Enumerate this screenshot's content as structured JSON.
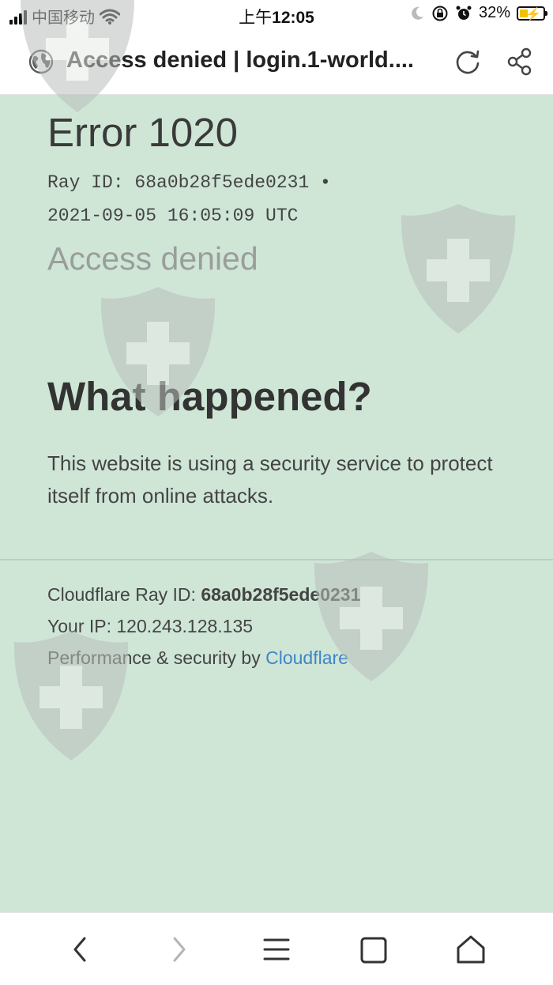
{
  "status_bar": {
    "carrier": "中国移动",
    "time_prefix": "上午",
    "time": "12:05",
    "battery_percent": "32%",
    "icons": [
      "signal-icon",
      "wifi-icon",
      "moon-icon",
      "orientation-lock-icon",
      "alarm-icon",
      "battery-charging-icon"
    ]
  },
  "browser": {
    "title": "Access denied | login.1-world....",
    "icons": [
      "globe-icon",
      "reload-icon",
      "share-icon"
    ]
  },
  "page": {
    "error_code": "Error 1020",
    "ray_line": "Ray ID: 68a0b28f5ede0231 •",
    "ray_time": "2021-09-05 16:05:09 UTC",
    "access_denied": "Access denied",
    "what_happened": "What happened?",
    "explanation": "This website is using a security service to protect itself from online attacks.",
    "footer": {
      "cf_ray_label": "Cloudflare Ray ID: ",
      "cf_ray_value": "68a0b28f5ede0231",
      "ip_label": "Your IP: ",
      "ip_value": "120.243.128.135",
      "perf_label": "Performance & security by ",
      "perf_link": "Cloudflare"
    }
  },
  "bottom_nav": {
    "items": [
      "back-icon",
      "forward-icon",
      "menu-icon",
      "tabs-icon",
      "home-icon"
    ]
  },
  "colors": {
    "page_background": "#cfe6d7",
    "link": "#3f85c7",
    "battery_fill": "#f2c200"
  }
}
